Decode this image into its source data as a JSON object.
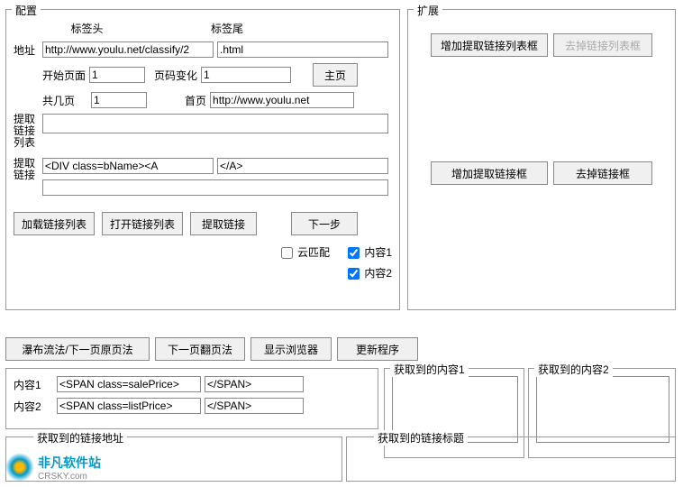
{
  "config": {
    "title": "配置",
    "tag_head": "标签头",
    "tag_tail": "标签尾",
    "address_label": "地址",
    "address_head": "http://www.youlu.net/classify/2",
    "address_tail": ".html",
    "start_page_label": "开始页面",
    "start_page": "1",
    "page_change_label": "页码变化",
    "page_change": "1",
    "home_btn": "主页",
    "total_pages_label": "共几页",
    "total_pages": "1",
    "first_page_label": "首页",
    "first_page_url": "http://www.youlu.net",
    "extract_list_label": "提取\n链接\n列表",
    "extract_link_label": "提取\n链接",
    "link_head": "<DIV class=bName><A",
    "link_tail": "</A>",
    "btn_load_list": "加载链接列表",
    "btn_open_list": "打开链接列表",
    "btn_extract": "提取链接",
    "btn_next": "下一步",
    "cloud_match": "云匹配",
    "content1": "内容1",
    "content2": "内容2"
  },
  "ext": {
    "title": "扩展",
    "btn_add_list": "增加提取链接列表框",
    "btn_remove_list": "去掉链接列表框",
    "btn_add_link": "增加提取链接框",
    "btn_remove_link": "去掉链接框"
  },
  "mid": {
    "btn_waterfall": "瀑布流法/下一页原页法",
    "btn_nextpage": "下一页翻页法",
    "btn_browser": "显示浏览器",
    "btn_update": "更新程序"
  },
  "content": {
    "label1": "内容1",
    "head1": "<SPAN class=salePrice>",
    "tail1": "</SPAN>",
    "label2": "内容2",
    "head2": "<SPAN class=listPrice>",
    "tail2": "</SPAN>"
  },
  "results": {
    "got_content1": "获取到的内容1",
    "got_content2": "获取到的内容2",
    "got_link_addr": "获取到的链接地址",
    "got_link_title": "获取到的链接标题"
  },
  "watermark": {
    "name": "非凡软件站",
    "sub": "CRSKY.com"
  }
}
